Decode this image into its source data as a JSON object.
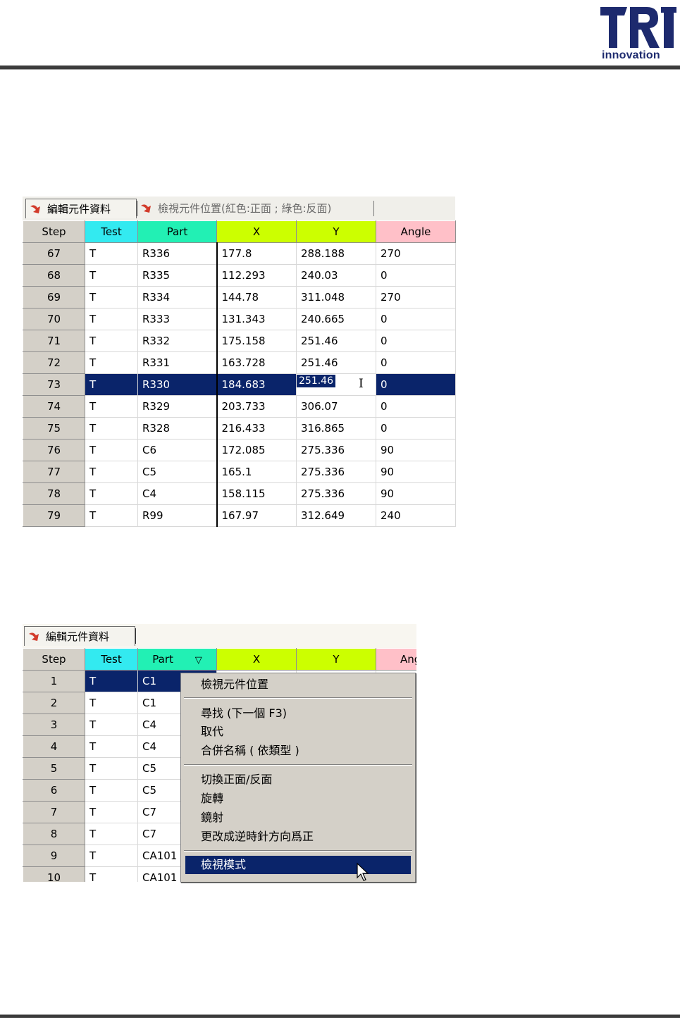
{
  "logo": {
    "brand": "TRI",
    "tagline": "innovation"
  },
  "panel1": {
    "tabs": [
      {
        "label": "編輯元件資料"
      },
      {
        "label": "檢視元件位置(紅色:正面 ; 綠色:反面)"
      }
    ],
    "columns": [
      "Step",
      "Test",
      "Part",
      "X",
      "Y",
      "Angle"
    ],
    "rows": [
      [
        "67",
        "T",
        "R336",
        "177.8",
        "288.188",
        "270"
      ],
      [
        "68",
        "T",
        "R335",
        "112.293",
        "240.03",
        "0"
      ],
      [
        "69",
        "T",
        "R334",
        "144.78",
        "311.048",
        "270"
      ],
      [
        "70",
        "T",
        "R333",
        "131.343",
        "240.665",
        "0"
      ],
      [
        "71",
        "T",
        "R332",
        "175.158",
        "251.46",
        "0"
      ],
      [
        "72",
        "T",
        "R331",
        "163.728",
        "251.46",
        "0"
      ],
      [
        "73",
        "T",
        "R330",
        "184.683",
        "251.46",
        "0"
      ],
      [
        "74",
        "T",
        "R329",
        "203.733",
        "306.07",
        "0"
      ],
      [
        "75",
        "T",
        "R328",
        "216.433",
        "316.865",
        "0"
      ],
      [
        "76",
        "T",
        "C6",
        "172.085",
        "275.336",
        "90"
      ],
      [
        "77",
        "T",
        "C5",
        "165.1",
        "275.336",
        "90"
      ],
      [
        "78",
        "T",
        "C4",
        "158.115",
        "275.336",
        "90"
      ],
      [
        "79",
        "T",
        "R99",
        "167.97",
        "312.649",
        "240"
      ]
    ],
    "selected_step": "73"
  },
  "panel2": {
    "tabs": [
      {
        "label": "編輯元件資料"
      }
    ],
    "columns": [
      "Step",
      "Test",
      "Part",
      "X",
      "Y",
      "Ang"
    ],
    "rows": [
      [
        "1",
        "T",
        "C1"
      ],
      [
        "2",
        "T",
        "C1"
      ],
      [
        "3",
        "T",
        "C4"
      ],
      [
        "4",
        "T",
        "C4"
      ],
      [
        "5",
        "T",
        "C5"
      ],
      [
        "6",
        "T",
        "C5"
      ],
      [
        "7",
        "T",
        "C7"
      ],
      [
        "8",
        "T",
        "C7"
      ],
      [
        "9",
        "T",
        "CA101"
      ],
      [
        "10",
        "T",
        "CA101"
      ]
    ],
    "context_menu": [
      "檢視元件位置",
      "尋找 (下一個 F3)",
      "取代",
      "合併名稱 ( 依類型 )",
      "切換正面/反面",
      "旋轉",
      "鏡射",
      "更改成逆時針方向爲正",
      "檢視模式"
    ]
  },
  "colors": {
    "test_header": "#33eaf0",
    "part_header": "#22f0b4",
    "xy_header": "#ccff00",
    "angle_header": "#ffc0c8",
    "selection": "#0a246a",
    "logo": "#1d2a6e"
  }
}
